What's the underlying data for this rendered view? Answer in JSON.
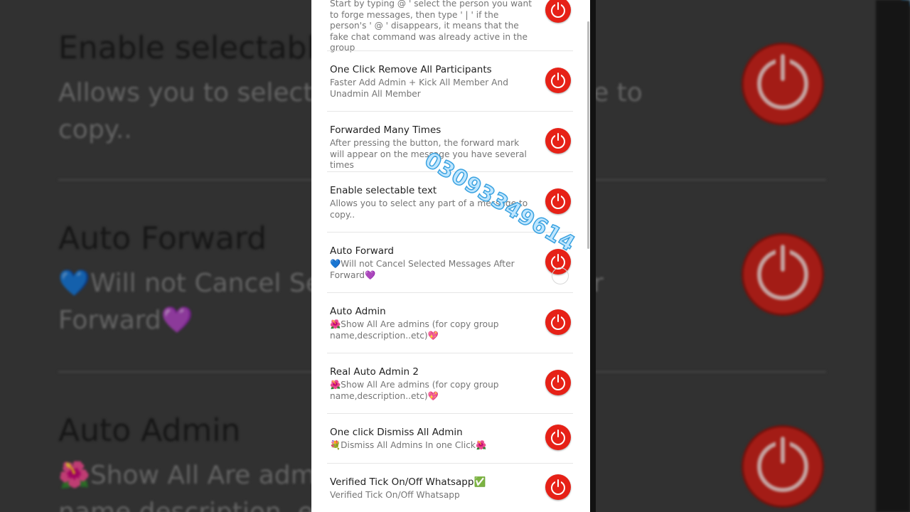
{
  "bg": {
    "items": [
      {
        "title": "Enable selectable text",
        "desc1": "Allows you to select any part of a message to",
        "desc2": "copy.."
      },
      {
        "title": "Auto Forward",
        "desc1": "💙Will not Cancel Selected Messages After",
        "desc2": "Forward💜"
      },
      {
        "title": "Auto Admin",
        "desc1": "🌺Show All Are admins (for copy group",
        "desc2": "name,description..etc)💖"
      }
    ],
    "watermark": "03093349614"
  },
  "items": [
    {
      "title": "",
      "desc": "Start by typing @ ' select the person you want to forge messages, then type ' | ' if the person's ' @ ' disappears, it means that the fake chat command was already active in the group"
    },
    {
      "title": "One Click Remove All Participants",
      "desc": "Faster Add Admin + Kick All Member And Unadmin All Member"
    },
    {
      "title": "Forwarded Many Times",
      "desc": "After pressing the button, the forward mark will appear on the message you have several times"
    },
    {
      "title": "Enable selectable text",
      "desc": "Allows you to select any part of a message to copy.."
    },
    {
      "title": "Auto Forward",
      "desc": "💙Will not Cancel Selected Messages After Forward💜"
    },
    {
      "title": "Auto Admin",
      "desc": "🌺Show All Are admins (for copy group name,description..etc)💖"
    },
    {
      "title": "Real Auto Admin 2",
      "desc": "🌺Show All Are admins (for copy group name,description..etc)💖"
    },
    {
      "title": "One click Dismiss All Admin",
      "desc": "💐Dismiss All Admins In one Click🌺"
    },
    {
      "title": "Verified Tick On/Off Whatsapp✅",
      "desc": "Verified Tick On/Off Whatsapp"
    }
  ],
  "watermark": "03093349614",
  "colors": {
    "power": "#e62117",
    "background": "#3c3c3c"
  }
}
